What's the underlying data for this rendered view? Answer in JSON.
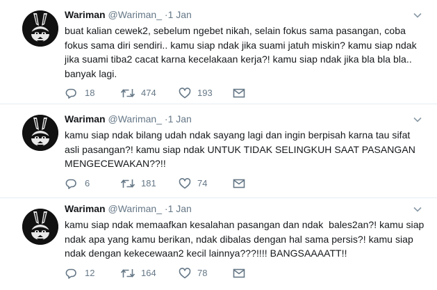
{
  "tweets": [
    {
      "name": "Wariman",
      "handle": "@Wariman_",
      "dot": "·",
      "time": "1 Jan",
      "lines": [
        "buat kalian cewek2, sebelum ngebet nikah, selain fokus sama pasangan, coba",
        "fokus sama diri sendiri.. kamu siap ndak jika suami jatuh miskin? kamu siap ndak",
        "jika suami tiba2 cacat karna kecelakaan kerja?! kamu siap ndak jika bla bla bla..",
        "banyak lagi."
      ],
      "replies": "18",
      "retweets": "474",
      "likes": "193"
    },
    {
      "name": "Wariman",
      "handle": "@Wariman_",
      "dot": "·",
      "time": "1 Jan",
      "lines": [
        "kamu siap ndak bilang udah ndak sayang lagi dan ingin berpisah karna tau sifat",
        "asli pasangan?! kamu siap ndak UNTUK TIDAK SELINGKUH SAAT PASANGAN",
        "MENGECEWAKAN??!!"
      ],
      "replies": "6",
      "retweets": "181",
      "likes": "74"
    },
    {
      "name": "Wariman",
      "handle": "@Wariman_",
      "dot": "·",
      "time": "1 Jan",
      "lines": [
        "kamu siap ndak memaafkan kesalahan pasangan dan ndak  bales2an?! kamu siap",
        "ndak apa yang kamu berikan, ndak dibalas dengan hal sama persis?! kamu siap",
        "ndak dengan kekecewaan2 kecil lainnya???!!!! BANGSAAAATT!!"
      ],
      "replies": "12",
      "retweets": "164",
      "likes": "78"
    }
  ],
  "icons": {
    "reply": "reply-icon",
    "retweet": "retweet-icon",
    "like": "heart-icon",
    "dm": "message-icon",
    "menu": "chevron-down-icon"
  },
  "colors": {
    "text": "#14171a",
    "muted": "#657786",
    "divider": "#e6ecf0"
  }
}
